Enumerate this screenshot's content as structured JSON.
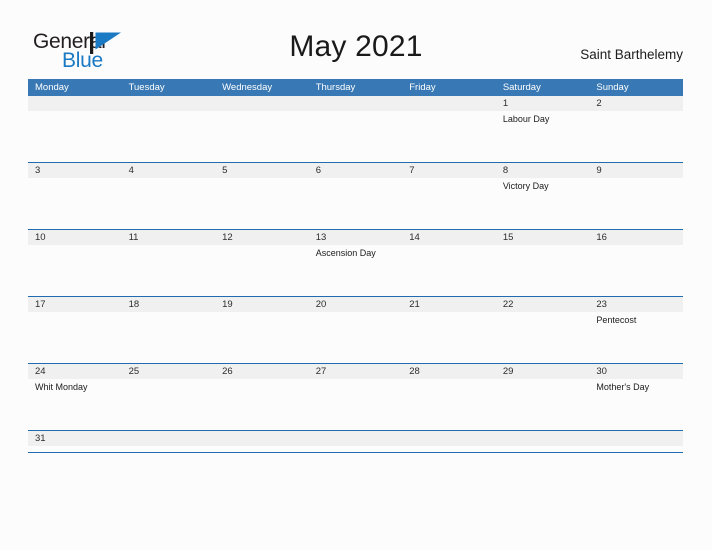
{
  "brand": {
    "name_part1": "General",
    "name_part2": "Blue",
    "mark": "triangle-flag-icon",
    "accent_color": "#1a7ac4",
    "text_color": "#231f20"
  },
  "header": {
    "title": "May 2021",
    "location": "Saint Barthelemy"
  },
  "theme": {
    "header_bar_color": "#3878b4",
    "row_rule_color": "#1f6cae",
    "date_band_color": "#f0f0f0",
    "page_background": "#fcfcfc"
  },
  "calendar": {
    "weekday_headers": [
      "Monday",
      "Tuesday",
      "Wednesday",
      "Thursday",
      "Friday",
      "Saturday",
      "Sunday"
    ],
    "weeks": [
      [
        {
          "day": "",
          "event": ""
        },
        {
          "day": "",
          "event": ""
        },
        {
          "day": "",
          "event": ""
        },
        {
          "day": "",
          "event": ""
        },
        {
          "day": "",
          "event": ""
        },
        {
          "day": "1",
          "event": "Labour Day"
        },
        {
          "day": "2",
          "event": ""
        }
      ],
      [
        {
          "day": "3",
          "event": ""
        },
        {
          "day": "4",
          "event": ""
        },
        {
          "day": "5",
          "event": ""
        },
        {
          "day": "6",
          "event": ""
        },
        {
          "day": "7",
          "event": ""
        },
        {
          "day": "8",
          "event": "Victory Day"
        },
        {
          "day": "9",
          "event": ""
        }
      ],
      [
        {
          "day": "10",
          "event": ""
        },
        {
          "day": "11",
          "event": ""
        },
        {
          "day": "12",
          "event": ""
        },
        {
          "day": "13",
          "event": "Ascension Day"
        },
        {
          "day": "14",
          "event": ""
        },
        {
          "day": "15",
          "event": ""
        },
        {
          "day": "16",
          "event": ""
        }
      ],
      [
        {
          "day": "17",
          "event": ""
        },
        {
          "day": "18",
          "event": ""
        },
        {
          "day": "19",
          "event": ""
        },
        {
          "day": "20",
          "event": ""
        },
        {
          "day": "21",
          "event": ""
        },
        {
          "day": "22",
          "event": ""
        },
        {
          "day": "23",
          "event": "Pentecost"
        }
      ],
      [
        {
          "day": "24",
          "event": "Whit Monday"
        },
        {
          "day": "25",
          "event": ""
        },
        {
          "day": "26",
          "event": ""
        },
        {
          "day": "27",
          "event": ""
        },
        {
          "day": "28",
          "event": ""
        },
        {
          "day": "29",
          "event": ""
        },
        {
          "day": "30",
          "event": "Mother's Day"
        }
      ],
      [
        {
          "day": "31",
          "event": ""
        },
        {
          "day": "",
          "event": ""
        },
        {
          "day": "",
          "event": ""
        },
        {
          "day": "",
          "event": ""
        },
        {
          "day": "",
          "event": ""
        },
        {
          "day": "",
          "event": ""
        },
        {
          "day": "",
          "event": ""
        }
      ]
    ]
  }
}
